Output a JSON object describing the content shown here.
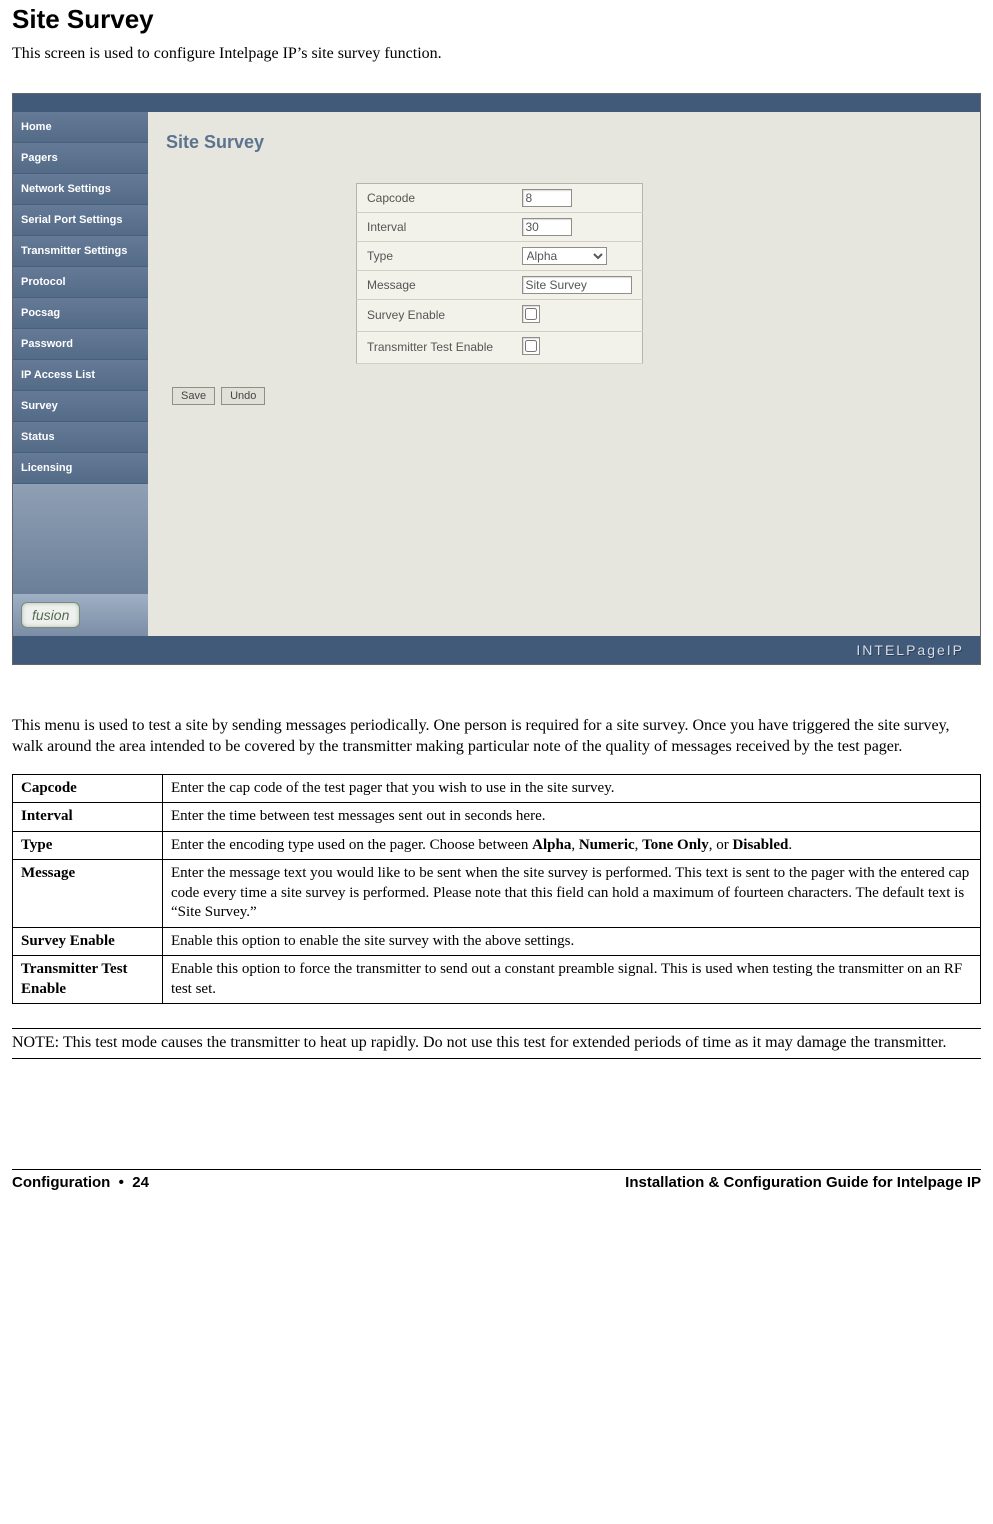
{
  "heading": "Site Survey",
  "intro": "This screen is used to configure Intelpage IP’s site survey function.",
  "screenshot": {
    "sidebar": {
      "items": [
        "Home",
        "Pagers",
        "Network Settings",
        "Serial Port Settings",
        "Transmitter Settings",
        "Protocol",
        "Pocsag",
        "Password",
        "IP Access List",
        "Survey",
        "Status",
        "Licensing"
      ],
      "brand": "fusion"
    },
    "section_title": "Site Survey",
    "form": {
      "capcode": {
        "label": "Capcode",
        "value": "8"
      },
      "interval": {
        "label": "Interval",
        "value": "30"
      },
      "type": {
        "label": "Type",
        "selected": "Alpha"
      },
      "message": {
        "label": "Message",
        "value": "Site Survey"
      },
      "survey_enable": {
        "label": "Survey Enable"
      },
      "tx_test_enable": {
        "label": "Transmitter Test Enable"
      }
    },
    "buttons": {
      "save": "Save",
      "undo": "Undo"
    },
    "footer_brand": "INTELPageIP"
  },
  "body_text": "This menu is used to test a site by sending messages periodically. One person is required for a site survey. Once you have triggered the site survey, walk around the area intended to be covered by the transmitter making particular note of the quality of messages received by the test pager.",
  "doc_table": {
    "rows": [
      {
        "term": "Capcode",
        "desc_plain": "Enter the cap code of the test pager that you wish to use in the site survey."
      },
      {
        "term": "Interval",
        "desc_plain": "Enter the time between test messages sent out in seconds here."
      },
      {
        "term": "Type",
        "desc_html": "Enter the encoding type used on the pager. Choose between <b>Alpha</b>, <b>Numeric</b>, <b>Tone Only</b>, or <b>Disabled</b>."
      },
      {
        "term": "Message",
        "desc_plain": "Enter the message text you would like to be sent when the site survey is performed. This text is sent to the pager with the entered cap code every time a site survey is performed. Please note that this field can hold a maximum of fourteen characters. The default text is “Site Survey.”"
      },
      {
        "term": "Survey Enable",
        "desc_plain": "Enable this option to enable the site survey with the above settings."
      },
      {
        "term": "Transmitter Test Enable",
        "desc_plain": "Enable this option to force the transmitter to send out a constant preamble signal. This is used when testing the transmitter on an RF test set."
      }
    ]
  },
  "note": "NOTE: This test mode causes the transmitter to heat up rapidly. Do not use this test for extended periods of time as it may damage the transmitter.",
  "footer": {
    "left_section": "Configuration",
    "left_page": "24",
    "right": "Installation & Configuration Guide for Intelpage IP"
  }
}
